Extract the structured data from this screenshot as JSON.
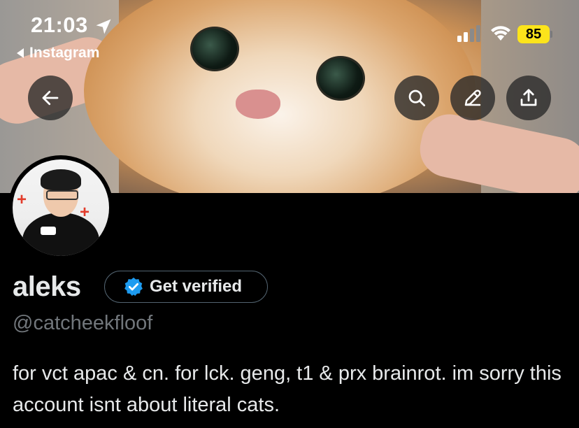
{
  "status_bar": {
    "time": "21:03",
    "back_app": "Instagram",
    "battery": "85",
    "battery_color": "#fce41b"
  },
  "header_actions": {
    "back": "back-arrow-icon",
    "search": "search-icon",
    "edit": "pencil-icon",
    "share": "share-icon"
  },
  "profile": {
    "display_name": "aleks",
    "verify_label": "Get verified",
    "handle": "@catcheekfloof",
    "bio": "for vct apac & cn. for lck. geng, t1 & prx brainrot. im sorry this account isnt about literal cats."
  },
  "colors": {
    "background": "#000000",
    "text_primary": "#e7e9ea",
    "text_secondary": "#71767b",
    "verified_blue": "#1d9bf0"
  }
}
